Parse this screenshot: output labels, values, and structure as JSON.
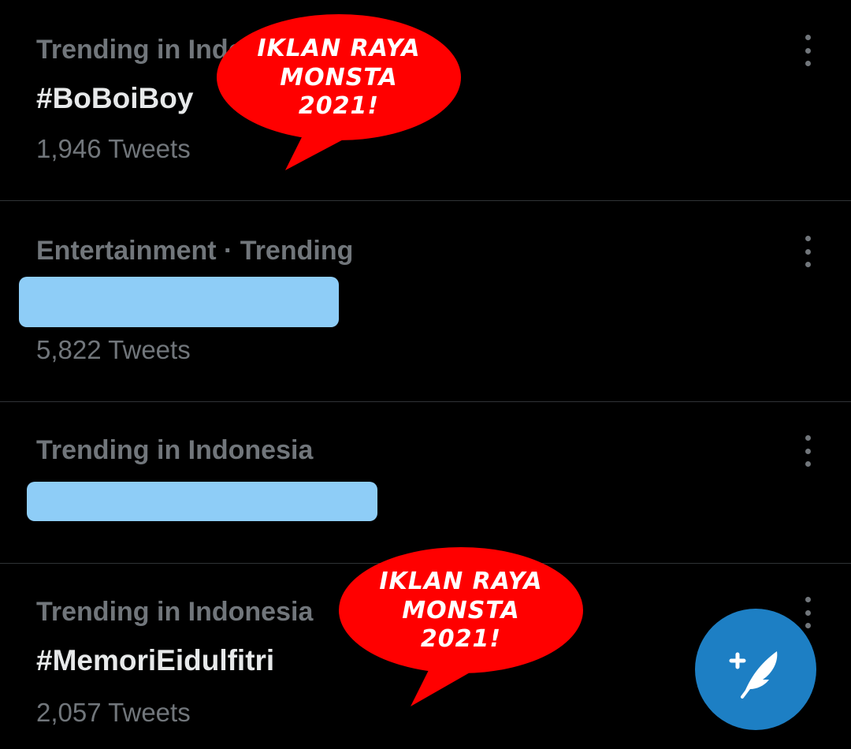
{
  "trends": [
    {
      "meta": "Trending in Indonesia",
      "topic": "#BoBoiBoy",
      "count": "1,946 Tweets",
      "redacted": false
    },
    {
      "meta": "Entertainment · Trending",
      "topic": "",
      "count": "5,822 Tweets",
      "redacted": true
    },
    {
      "meta": "Trending in Indonesia",
      "topic": "",
      "count": "",
      "redacted": true
    },
    {
      "meta": "Trending in Indonesia",
      "topic": "#MemoriEidulfitri",
      "count": "2,057 Tweets",
      "redacted": false
    }
  ],
  "annotations": [
    {
      "lines": [
        "IKLAN RAYA",
        "MONSTA",
        "2021!"
      ]
    },
    {
      "lines": [
        "IKLAN RAYA",
        "MONSTA",
        "2021!"
      ]
    }
  ],
  "colors": {
    "background": "#000000",
    "primary_text": "#e7e9ea",
    "secondary_text": "#71767b",
    "divider": "#2f3336",
    "redaction": "#8ecdf7",
    "bubble_red": "#ff0000",
    "fab_blue": "#1d7fc4"
  },
  "icons": {
    "more": "more-vertical-icon",
    "compose": "compose-tweet-icon"
  }
}
